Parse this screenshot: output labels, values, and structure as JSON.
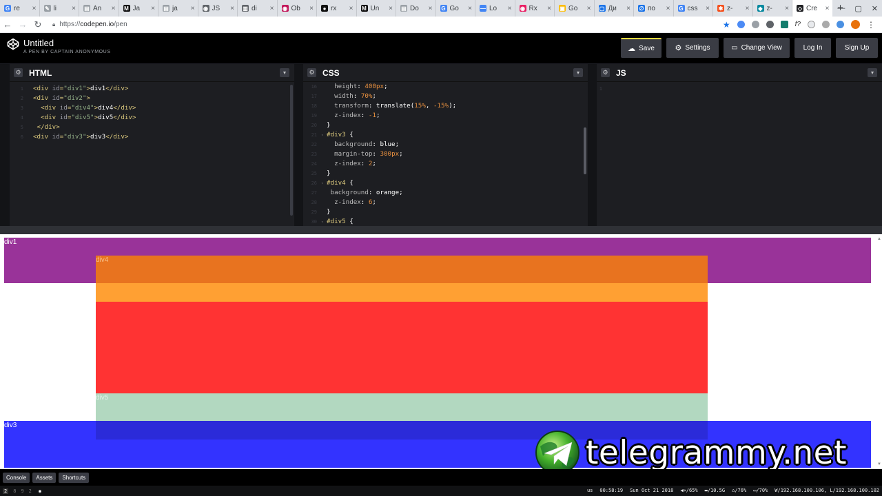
{
  "browser": {
    "tabs": [
      {
        "title": "re",
        "icon": "google-icon",
        "color": "#4285f4",
        "glyph": "G"
      },
      {
        "title": "li",
        "icon": "pen-icon",
        "color": "#9aa0a6",
        "glyph": "✎"
      },
      {
        "title": "An",
        "icon": "doc-icon",
        "color": "#9aa0a6",
        "glyph": "▤"
      },
      {
        "title": "Ja",
        "icon": "medium-icon",
        "color": "#111111",
        "glyph": "M"
      },
      {
        "title": "ja",
        "icon": "page-icon",
        "color": "#9aa0a6",
        "glyph": "▤"
      },
      {
        "title": "JS",
        "icon": "globe-icon",
        "color": "#5f6368",
        "glyph": "◉"
      },
      {
        "title": "di",
        "icon": "book-icon",
        "color": "#5f6368",
        "glyph": "▥"
      },
      {
        "title": "Ob",
        "icon": "observable-icon",
        "color": "#c2185b",
        "glyph": "◉"
      },
      {
        "title": "rx",
        "icon": "github-icon",
        "color": "#111111",
        "glyph": "●"
      },
      {
        "title": "Un",
        "icon": "medium-icon",
        "color": "#111111",
        "glyph": "M"
      },
      {
        "title": "Do",
        "icon": "page-icon",
        "color": "#9aa0a6",
        "glyph": "▤"
      },
      {
        "title": "Go",
        "icon": "translate-icon",
        "color": "#4285f4",
        "glyph": "G"
      },
      {
        "title": "Lo",
        "icon": "dash-icon",
        "color": "#4285f4",
        "glyph": "—"
      },
      {
        "title": "Rx",
        "icon": "rxjs-icon",
        "color": "#e91e63",
        "glyph": "◉"
      },
      {
        "title": "Go",
        "icon": "keep-icon",
        "color": "#fbbc04",
        "glyph": "▣"
      },
      {
        "title": "Ди",
        "icon": "app-icon",
        "color": "#1a73e8",
        "glyph": "▢"
      },
      {
        "title": "по",
        "icon": "link-icon",
        "color": "#1a73e8",
        "glyph": "∅"
      },
      {
        "title": "css",
        "icon": "google-icon",
        "color": "#4285f4",
        "glyph": "G"
      },
      {
        "title": "z-",
        "icon": "star-burst-icon",
        "color": "#f4511e",
        "glyph": "✱"
      },
      {
        "title": "z-",
        "icon": "shield-icon",
        "color": "#0b8aa0",
        "glyph": "◆"
      },
      {
        "title": "Cre",
        "icon": "codepen-icon",
        "color": "#202124",
        "glyph": "◇"
      }
    ],
    "active_tab_index": 20,
    "new_tab": "+",
    "url_scheme": "https://",
    "url_host": "codepen.io",
    "url_path": "/pen"
  },
  "codepen": {
    "title": "Untitled",
    "subtitle": "A PEN BY CAPTAIN ANONYMOUS",
    "buttons": {
      "save": "Save",
      "settings": "Settings",
      "change_view": "Change View",
      "login": "Log In",
      "signup": "Sign Up"
    },
    "panels": {
      "html": "HTML",
      "css": "CSS",
      "js": "JS"
    },
    "html_code": [
      {
        "n": "1",
        "parts": [
          [
            "tag",
            "<div "
          ],
          [
            "attr",
            "id"
          ],
          [
            "tag",
            "="
          ],
          [
            "str",
            "\"div1\""
          ],
          [
            "tag",
            ">"
          ],
          [
            "txt",
            "div1"
          ],
          [
            "tag",
            "</div>"
          ]
        ]
      },
      {
        "n": "2",
        "parts": [
          [
            "tag",
            "<div "
          ],
          [
            "attr",
            "id"
          ],
          [
            "tag",
            "="
          ],
          [
            "str",
            "\"div2\""
          ],
          [
            "tag",
            ">"
          ]
        ]
      },
      {
        "n": "3",
        "parts": [
          [
            "tag",
            "  <div "
          ],
          [
            "attr",
            "id"
          ],
          [
            "tag",
            "="
          ],
          [
            "str",
            "\"div4\""
          ],
          [
            "tag",
            ">"
          ],
          [
            "txt",
            "div4"
          ],
          [
            "tag",
            "</div>"
          ]
        ]
      },
      {
        "n": "4",
        "parts": [
          [
            "tag",
            "  <div "
          ],
          [
            "attr",
            "id"
          ],
          [
            "tag",
            "="
          ],
          [
            "str",
            "\"div5\""
          ],
          [
            "tag",
            ">"
          ],
          [
            "txt",
            "div5"
          ],
          [
            "tag",
            "</div>"
          ]
        ]
      },
      {
        "n": "5",
        "parts": [
          [
            "tag",
            " </div>"
          ]
        ]
      },
      {
        "n": "6",
        "parts": [
          [
            "tag",
            "<div "
          ],
          [
            "attr",
            "id"
          ],
          [
            "tag",
            "="
          ],
          [
            "str",
            "\"div3\""
          ],
          [
            "tag",
            ">"
          ],
          [
            "txt",
            "div3"
          ],
          [
            "tag",
            "</div>"
          ]
        ]
      }
    ],
    "css_code": [
      {
        "n": "16",
        "parts": [
          [
            "prop",
            "  height"
          ],
          [
            "val",
            ": "
          ],
          [
            "num",
            "400px"
          ],
          [
            "val",
            ";"
          ]
        ]
      },
      {
        "n": "17",
        "parts": [
          [
            "prop",
            "  width"
          ],
          [
            "val",
            ": "
          ],
          [
            "num",
            "70%"
          ],
          [
            "val",
            ";"
          ]
        ]
      },
      {
        "n": "18",
        "parts": [
          [
            "prop",
            "  transform"
          ],
          [
            "val",
            ": translate("
          ],
          [
            "num",
            "15%"
          ],
          [
            "val",
            ", "
          ],
          [
            "num",
            "-15%"
          ],
          [
            "val",
            ");"
          ]
        ]
      },
      {
        "n": "19",
        "parts": [
          [
            "prop",
            "  z-index"
          ],
          [
            "val",
            ": "
          ],
          [
            "num",
            "-1"
          ],
          [
            "val",
            ";"
          ]
        ]
      },
      {
        "n": "20",
        "parts": [
          [
            "val",
            "}"
          ]
        ]
      },
      {
        "n": "21",
        "parts": [
          [
            "sel",
            "#div3"
          ],
          [
            "val",
            " {"
          ]
        ]
      },
      {
        "n": "22",
        "parts": [
          [
            "prop",
            "  background"
          ],
          [
            "val",
            ": blue;"
          ]
        ]
      },
      {
        "n": "23",
        "parts": [
          [
            "prop",
            "  margin-top"
          ],
          [
            "val",
            ": "
          ],
          [
            "num",
            "300px"
          ],
          [
            "val",
            ";"
          ]
        ]
      },
      {
        "n": "24",
        "parts": [
          [
            "prop",
            "  z-index"
          ],
          [
            "val",
            ": "
          ],
          [
            "num",
            "2"
          ],
          [
            "val",
            ";"
          ]
        ]
      },
      {
        "n": "25",
        "parts": [
          [
            "val",
            "}"
          ]
        ]
      },
      {
        "n": "26",
        "parts": [
          [
            "sel",
            "#div4"
          ],
          [
            "val",
            " {"
          ]
        ]
      },
      {
        "n": "27",
        "parts": [
          [
            "prop",
            " background"
          ],
          [
            "val",
            ": orange;"
          ]
        ]
      },
      {
        "n": "28",
        "parts": [
          [
            "prop",
            "  z-index"
          ],
          [
            "val",
            ": "
          ],
          [
            "num",
            "6"
          ],
          [
            "val",
            ";"
          ]
        ]
      },
      {
        "n": "29",
        "parts": [
          [
            "val",
            "}"
          ]
        ]
      },
      {
        "n": "30",
        "parts": [
          [
            "sel",
            "#div5"
          ],
          [
            "val",
            " {"
          ]
        ]
      }
    ],
    "js_code": [
      {
        "n": "1",
        "parts": []
      }
    ],
    "preview": {
      "div1": "div1",
      "div4": "div4",
      "div5": "div5",
      "div3": "div3",
      "colors": {
        "purple": "#993399",
        "orange": "#ffa033",
        "orange_dark": "#e8731f",
        "red": "#ff3333",
        "green": "#b2d8c0",
        "blue": "#3333ff",
        "blue_dark": "#2b2bd9"
      }
    },
    "footer": {
      "console": "Console",
      "assets": "Assets",
      "shortcuts": "Shortcuts"
    }
  },
  "watermark": "telegrammy.net",
  "taskbar": {
    "workspaces": [
      "2",
      "8",
      "9",
      "2"
    ],
    "layout": "us",
    "time": "00:58:19",
    "date": "Sun Oct 21 2018",
    "volume": "◀»/65%",
    "memory": "▬/10.5G",
    "cpu": "⌂/76%",
    "disk": "▭/70%",
    "network": "W/192.168.100.106, L/192.168.100.102"
  }
}
